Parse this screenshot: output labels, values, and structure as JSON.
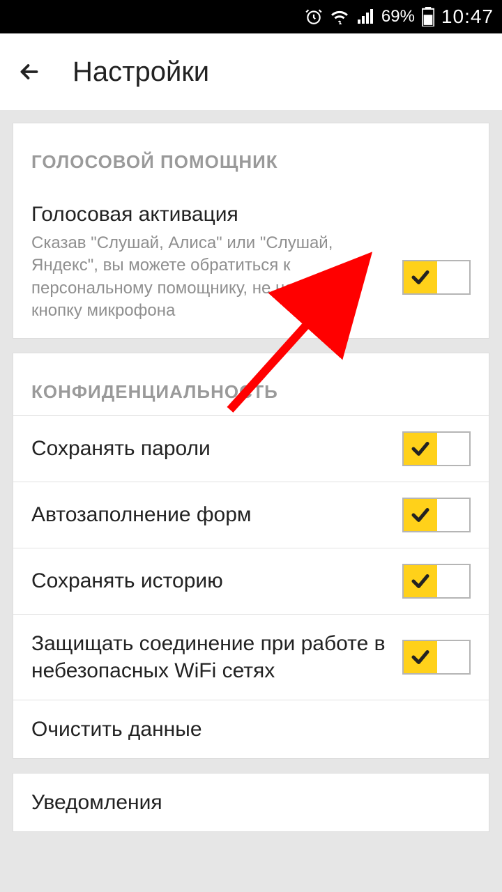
{
  "status": {
    "battery": "69%",
    "time": "10:47"
  },
  "header": {
    "title": "Настройки"
  },
  "sections": {
    "voice": {
      "header": "ГОЛОСОВОЙ ПОМОЩНИК",
      "item_title": "Голосовая активация",
      "item_desc": "Сказав \"Слушай, Алиса\" или \"Слушай, Яндекс\", вы можете обратиться к персональному помощнику, не нажимая кнопку микрофона"
    },
    "privacy": {
      "header": "КОНФИДЕНЦИАЛЬНОСТЬ",
      "save_passwords": "Сохранять пароли",
      "autofill": "Автозаполнение форм",
      "save_history": "Сохранять историю",
      "protect_wifi": "Защищать соединение при работе в небезопасных WiFi сетях",
      "clear_data": "Очистить данные"
    },
    "notifications": {
      "header": "Уведомления"
    }
  }
}
